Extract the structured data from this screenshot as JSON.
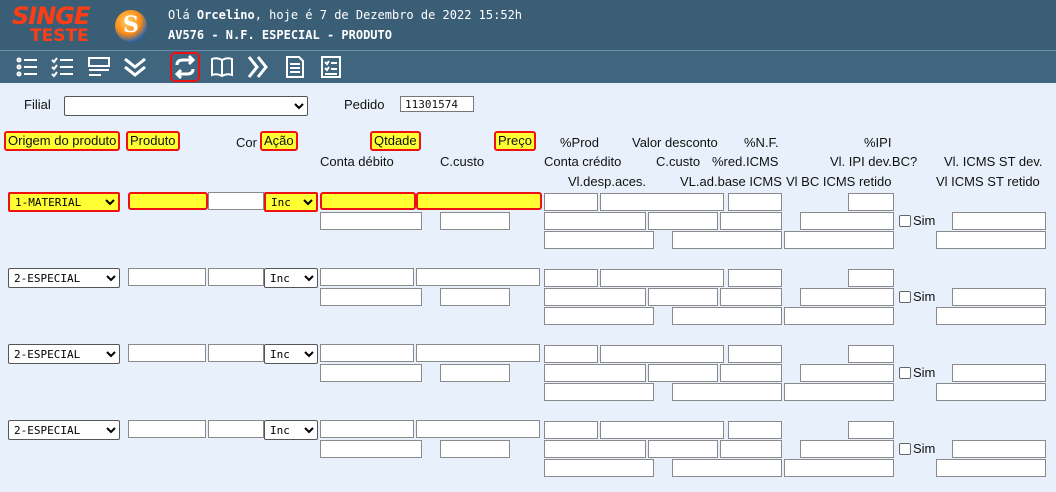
{
  "header": {
    "logo_top": "SINGE",
    "logo_bottom": "TESTE",
    "logo_glyph": "S",
    "greeting_prefix": "Olá",
    "user": "Orcelino",
    "greeting_suffix": ", hoje é 7 de Dezembro de 2022 15:52h",
    "screen_title": "AV576 - N.F. ESPECIAL - PRODUTO"
  },
  "toolbar": {
    "icons": [
      "list-icon",
      "checklist-icon",
      "form-icon",
      "double-chevron-down-icon",
      "refresh-arrows-icon",
      "book-icon",
      "double-chevron-right-icon",
      "document-icon",
      "checklist-doc-icon"
    ],
    "selected": "refresh-arrows-icon"
  },
  "filter": {
    "filial_label": "Filial",
    "filial_value": "",
    "pedido_label": "Pedido",
    "pedido_value": "11301574"
  },
  "columns": {
    "origem": "Origem do produto",
    "produto": "Produto",
    "cor": "Cor",
    "acao": "Ação",
    "qtdade": "Qtdade",
    "preco": "Preço",
    "prod_pct": "%Prod",
    "valor_desconto": "Valor desconto",
    "nf_pct": "%N.F.",
    "ipi_pct": "%IPI",
    "conta_debito": "Conta débito",
    "c_custo": "C.custo",
    "conta_credito": "Conta crédito",
    "c_custo_2": "C.custo",
    "red_icms_pct": "%red.ICMS",
    "vl_ipi_dev_bc": "Vl. IPI dev.BC?",
    "vl_icms_st_dev": "Vl. ICMS ST dev.",
    "vl_desp_aces": "Vl.desp.aces.",
    "vl_ad_base_icms": "VL.ad.base ICMS",
    "vl_bc_icms_retido": "Vl BC ICMS retido",
    "vl_icms_st_retido": "Vl ICMS ST retido"
  },
  "rows": [
    {
      "origem": "1-MATERIAL",
      "acao": "Inc",
      "sim_label": "Sim",
      "highlight": true
    },
    {
      "origem": "2-ESPECIAL",
      "acao": "Inc",
      "sim_label": "Sim",
      "highlight": false
    },
    {
      "origem": "2-ESPECIAL",
      "acao": "Inc",
      "sim_label": "Sim",
      "highlight": false
    },
    {
      "origem": "2-ESPECIAL",
      "acao": "Inc",
      "sim_label": "Sim",
      "highlight": false
    }
  ],
  "colors": {
    "header_bg": "#3b5e77",
    "toolbar_bg": "#40667f",
    "page_bg": "#e8f1fb",
    "highlight": "#ffff33",
    "highlight_border": "#e11",
    "logo": "#ff3d14"
  }
}
